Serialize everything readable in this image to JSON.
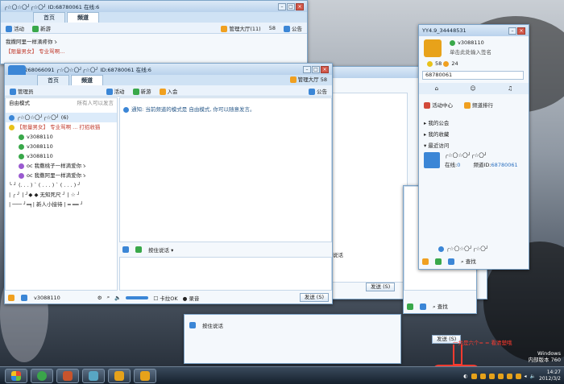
{
  "desktop": {
    "taskbar_apps": [
      "windows",
      "chrome",
      "app3",
      "app4",
      "yy1",
      "yy2"
    ],
    "tray": {
      "time": "14:27",
      "date": "2012/3/2",
      "os_label": "Windows",
      "build_label": "内部版本 760"
    },
    "annotation": "一共是六个= = 看清楚哦"
  },
  "window_back": {
    "title": "╭☆〇☆〇╯╭☆〇╯ ID:68780061 在线:6",
    "tabs": [
      "首页",
      "频道"
    ],
    "toolbar": [
      "活动",
      "新游"
    ],
    "top_right": [
      "管理大厅(11)",
      "58",
      "公告"
    ],
    "rows": [
      "我撒阿里一样滴疼你ゝ",
      "【限量男女】 专业骂啊..."
    ]
  },
  "window_main": {
    "title": "YY4.9.268066091 ╭☆〇☆〇╯╭☆〇╯ ID:68780061 在线:6",
    "tabs": [
      "首页",
      "频道"
    ],
    "top_right": [
      "管理大厅",
      "58"
    ],
    "toolbar": [
      "活动",
      "新游",
      "入会",
      "公告"
    ],
    "left_header": "管理员",
    "mode_label": "自由模式",
    "mode_hint": "所有人可以发言",
    "tree": [
      "╭☆〇☆〇╯╭☆〇╯ (6)",
      "【限量男女】 专业骂啊 ... 打招收猫",
      "v3088110",
      "v3088110",
      "v3088110",
      "oc  我撒桃子一样滴爱你ゝ",
      "oc  我撒阿里一样滴爱你ゝ",
      "╰ ╯ (. . . ) ` ( . . . ) ` ( . . . ) ╯",
      "| ╭ ╯ | ╯◆ ◆ 无知死尺 ╯ | ☆ ╯",
      "| ─── ╯═╕| 新人小接待 | ═ ══ ╯"
    ],
    "notice": "通知: 当前频道的模式是 自由模式, 你可以随意发言。",
    "voice_mode": "按住说话",
    "bottom_user": "v3088110",
    "cardioid": "卡拉OK",
    "record": "录音",
    "send": "发送 (S)"
  },
  "window_mid": {
    "voice_mode": "按住说话",
    "send": "发送 (S)"
  },
  "window_low": {
    "voice_mode": "按住说话",
    "send": "发送 (S)"
  },
  "mini_panel": {
    "title": "YY4.9_34448531",
    "user": "v3088110",
    "status": "单击此处输入签名",
    "stats": [
      "58",
      "24"
    ],
    "search_value": "68780061",
    "links": [
      "活动中心",
      "频道排行"
    ],
    "sections": [
      "我的公会",
      "我的收藏",
      "最近访问"
    ],
    "recent_name": "╭☆〇☆〇╯╭☆〇╯",
    "recent_online_label": "在线:",
    "recent_online": "0",
    "recent_id_label": "频道ID:",
    "recent_id": "68780061",
    "footer": "╭☆〇☆〇╯╭☆〇╯",
    "search_btn": "查找"
  },
  "side_win": {
    "search_btn": "查找"
  },
  "colors": {
    "accent": "#3b86d6",
    "window_bg": "#f4f8fc",
    "title_bg": "#b9d2ec",
    "annotation": "#ff3b2f"
  }
}
